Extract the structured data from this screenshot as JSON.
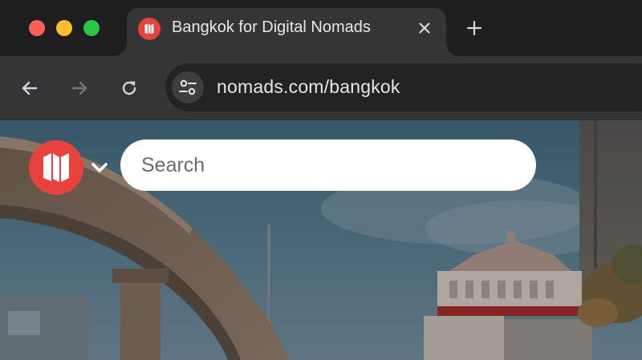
{
  "browser": {
    "tab": {
      "title": "Bangkok for Digital Nomads",
      "favicon": "nomads-map-logo-icon"
    },
    "address_bar": {
      "url": "nomads.com/bangkok"
    },
    "colors": {
      "close": "#ff5f57",
      "minimize": "#febc2e",
      "maximize": "#28c840"
    }
  },
  "page": {
    "logo": {
      "icon": "folded-map-icon",
      "color": "#e9413b"
    },
    "search": {
      "placeholder": "Search"
    }
  }
}
